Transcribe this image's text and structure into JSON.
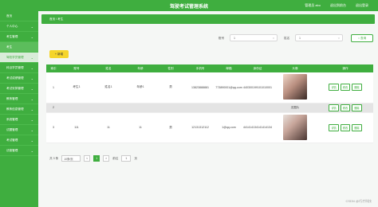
{
  "app": {
    "title": "驾驶考试管理系统"
  },
  "top_links": [
    {
      "label": "管理员 abo"
    },
    {
      "label": "退出到前台"
    },
    {
      "label": "退出登录"
    }
  ],
  "sidebar": {
    "items": [
      {
        "label": "首页"
      },
      {
        "label": "个人中心"
      },
      {
        "label": "考生管理"
      },
      {
        "label": "考生"
      },
      {
        "label": "驾校学员管理"
      },
      {
        "label": "科目学员管理"
      },
      {
        "label": "考试成绩管理"
      },
      {
        "label": "考试安排管理"
      },
      {
        "label": "教练管理"
      },
      {
        "label": "教练信息管理"
      },
      {
        "label": "系统管理"
      },
      {
        "label": "试题管理"
      },
      {
        "label": "考试管理"
      },
      {
        "label": "试卷管理"
      }
    ]
  },
  "breadcrumb": "首页 / 考生",
  "search": {
    "label1": "账号",
    "value1": "1",
    "label2": "姓名",
    "value2": "1",
    "button": "查询"
  },
  "add_button": "新增",
  "table": {
    "headers": [
      "索引",
      "账号",
      "姓名",
      "年龄",
      "性别",
      "手机号",
      "邮箱",
      "身份证",
      "头像",
      "操作"
    ],
    "rows": [
      {
        "index": "1",
        "account": "考生1",
        "name": "姓名1",
        "age": "年龄1",
        "gender": "男",
        "phone": "13823888881",
        "email": "773890001@qq.com",
        "idcard": "440300199101010001",
        "avatar": "photo",
        "ops": [
          "详情",
          "修改",
          "删除"
        ]
      },
      {
        "index": "2",
        "account": "",
        "name": "",
        "age": "",
        "gender": "",
        "phone": "",
        "email": "",
        "idcard": "",
        "avatar": "无图片",
        "ops": [
          "详情",
          "修改",
          "删除"
        ]
      },
      {
        "index": "3",
        "account": "111",
        "name": "11",
        "age": "11",
        "gender": "男",
        "phone": "12131312112",
        "email": "1@qq.com",
        "idcard": "441414134141414134",
        "avatar": "photo",
        "ops": [
          "详情",
          "修改",
          "删除"
        ]
      }
    ]
  },
  "pager": {
    "total": "共 3 条",
    "page_size": "10条/页",
    "prev": "<",
    "current": "1",
    "next": ">",
    "goto_label": "前往",
    "goto_value": "1",
    "page_suffix": "页"
  },
  "watermark": "CSDN @巧才科技"
}
